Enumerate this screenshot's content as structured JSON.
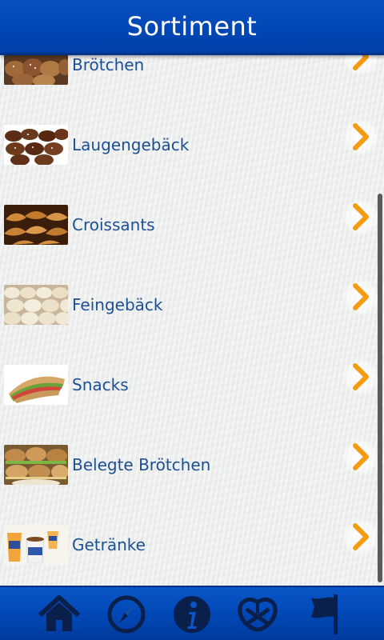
{
  "header": {
    "title": "Sortiment"
  },
  "list": {
    "items": [
      {
        "label": "Brötchen",
        "image": "broetchen-image"
      },
      {
        "label": "Laugengebäck",
        "image": "laugengebaeck-image"
      },
      {
        "label": "Croissants",
        "image": "croissants-image"
      },
      {
        "label": "Feingebäck",
        "image": "feingebaeck-image"
      },
      {
        "label": "Snacks",
        "image": "snacks-image"
      },
      {
        "label": "Belegte Brötchen",
        "image": "belegte-broetchen-image"
      },
      {
        "label": "Getränke",
        "image": "getraenke-image"
      }
    ]
  },
  "bottom_nav": {
    "items": [
      {
        "icon": "home-icon"
      },
      {
        "icon": "compass-icon"
      },
      {
        "icon": "info-icon"
      },
      {
        "icon": "pretzel-icon"
      },
      {
        "icon": "flag-icon"
      }
    ]
  },
  "colors": {
    "header_blue": "#0046b4",
    "label_blue": "#1d4f95",
    "chevron_orange": "#f39c12",
    "background": "#eceeed"
  }
}
